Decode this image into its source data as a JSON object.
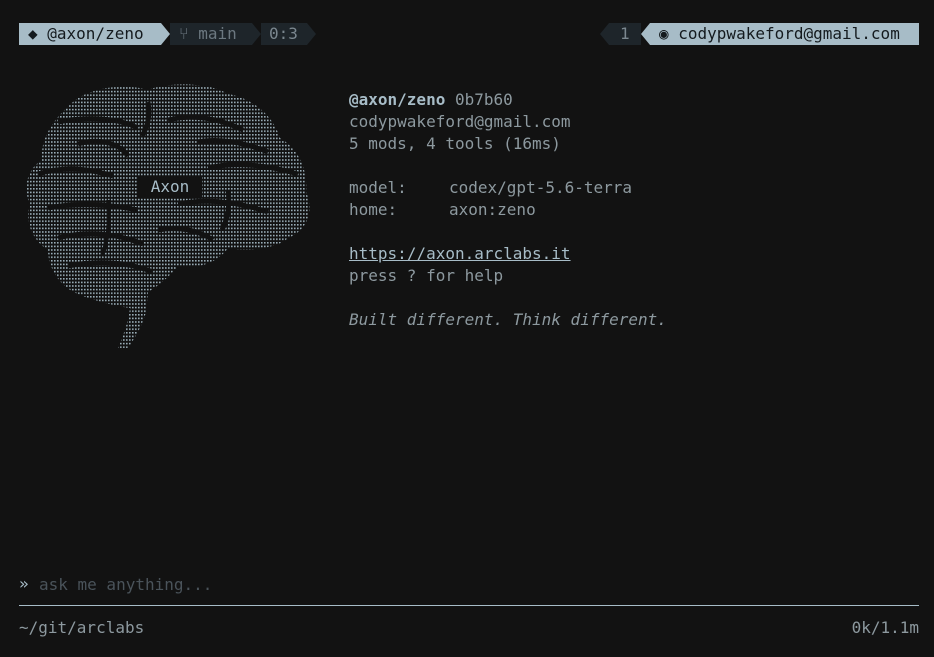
{
  "statusbar": {
    "repo": "◆ @axon/zeno",
    "branch": "⑂ main",
    "ratio": "0:3",
    "count": "1",
    "user": "◉ codypwakeford@gmail.com"
  },
  "logo": {
    "label": "Axon"
  },
  "info": {
    "handle": "@axon/zeno",
    "hash": "0b7b60",
    "email": "codypwakeford@gmail.com",
    "summary": "5 mods, 4 tools (16ms)",
    "model_key": "model:",
    "model_value": "codex/gpt-5.6-terra",
    "home_key": "home:",
    "home_value": "axon:zeno",
    "url": "https://axon.arclabs.it",
    "help": "press ? for help",
    "tagline": "Built different. Think different."
  },
  "prompt": {
    "marker": "»",
    "placeholder": "ask me anything..."
  },
  "footer": {
    "path": "~/git/arclabs",
    "tokens": "0k/1.1m"
  },
  "colors": {
    "accent": "#a7bcc7",
    "background": "#121212",
    "segment_dark": "#1e252a",
    "muted": "#8d999f"
  }
}
